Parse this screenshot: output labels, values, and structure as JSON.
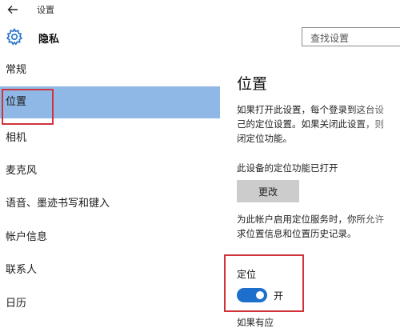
{
  "titlebar": {
    "back_icon": "arrow-left-icon",
    "app_title": "设置"
  },
  "header": {
    "icon": "gear-icon",
    "title": "隐私",
    "search_placeholder": "查找设置"
  },
  "sidebar": {
    "items": [
      {
        "label": "常规"
      },
      {
        "label": "位置",
        "selected": true
      },
      {
        "label": "相机"
      },
      {
        "label": "麦克风"
      },
      {
        "label": "语音、墨迹书写和键入"
      },
      {
        "label": "帐户信息"
      },
      {
        "label": "联系人"
      },
      {
        "label": "日历"
      }
    ]
  },
  "content": {
    "title": "位置",
    "intro": "如果打开此设置，每个登录到这台设\n己的定位设置。如果关闭此设置，则\n闭定位功能。",
    "device_status": "此设备的定位功能已打开",
    "change_button": "更改",
    "account_text": "为此帐户启用定位服务时，你所允许\n求位置信息和位置历史记录。",
    "toggle_label": "定位",
    "toggle_state": "开",
    "bottom_text": "如果有应"
  },
  "colors": {
    "selected_bg": "#8fb8e6",
    "accent": "#1e6fcc",
    "highlight_box": "#d0343b",
    "button_bg": "#cccccc"
  }
}
